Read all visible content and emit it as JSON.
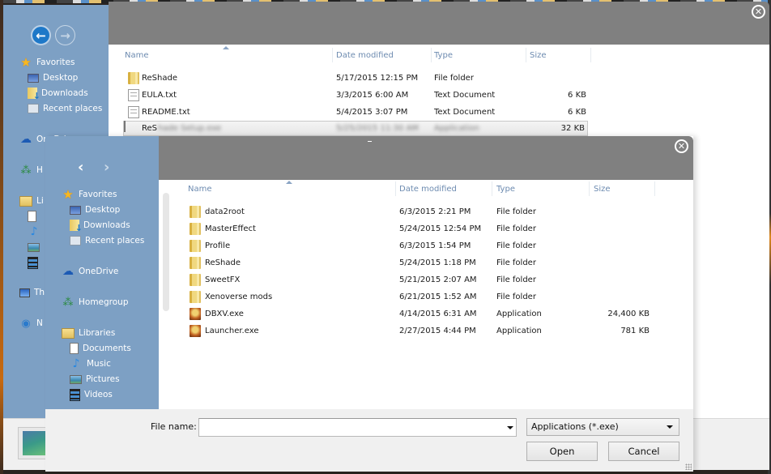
{
  "background_window": {
    "nav": {
      "back_icon": "arrow-left-icon",
      "forward_icon": "arrow-right-icon"
    },
    "sidebar": {
      "items": [
        {
          "label": "Favorites",
          "icon": "star-icon"
        },
        {
          "label": "Desktop",
          "icon": "desktop-icon"
        },
        {
          "label": "Downloads",
          "icon": "downloads-icon"
        },
        {
          "label": "Recent places",
          "icon": "recent-places-icon"
        },
        {
          "label": "OneDrive",
          "icon": "onedrive-icon"
        },
        {
          "label": "Homegroup",
          "icon": "homegroup-icon"
        },
        {
          "label": "Libraries",
          "icon": "libraries-icon"
        },
        {
          "label": "This PC",
          "icon": "computer-icon"
        },
        {
          "label": "Network",
          "icon": "network-icon"
        }
      ],
      "visible_fragments": {
        "onedrive": "OneDrive",
        "homegroup": "H",
        "libraries": "Li",
        "thispc": "Th",
        "network": "N"
      }
    },
    "columns": {
      "name": "Name",
      "date": "Date modified",
      "type": "Type",
      "size": "Size"
    },
    "files": [
      {
        "name": "ReShade",
        "date": "5/17/2015 12:15 PM",
        "type": "File folder",
        "size": "",
        "icon": "folder-icon"
      },
      {
        "name": "EULA.txt",
        "date": "3/3/2015 6:00 AM",
        "type": "Text Document",
        "size": "6 KB",
        "icon": "text-file-icon"
      },
      {
        "name": "README.txt",
        "date": "5/4/2015 3:07 PM",
        "type": "Text Document",
        "size": "6 KB",
        "icon": "text-file-icon"
      },
      {
        "name": "ReShade Setup.exe",
        "name_visible": "ReS",
        "name_blurred": "hade Setup.exe",
        "date": "5/25/2015 11:30 AM",
        "type": "Application",
        "size": "32 KB",
        "icon": "installer-icon"
      }
    ],
    "close_icon": "close-icon"
  },
  "dialog": {
    "title": "",
    "nav": {
      "back_icon": "chevron-left-icon",
      "forward_icon": "chevron-right-icon"
    },
    "sidebar": {
      "groups": [
        {
          "label": "Favorites",
          "icon": "star-icon",
          "children": [
            {
              "label": "Desktop",
              "icon": "desktop-icon"
            },
            {
              "label": "Downloads",
              "icon": "downloads-icon"
            },
            {
              "label": "Recent places",
              "icon": "recent-places-icon"
            }
          ]
        },
        {
          "label": "OneDrive",
          "icon": "onedrive-icon",
          "children": []
        },
        {
          "label": "Homegroup",
          "icon": "homegroup-icon",
          "children": []
        },
        {
          "label": "Libraries",
          "icon": "libraries-icon",
          "children": [
            {
              "label": "Documents",
              "icon": "documents-icon"
            },
            {
              "label": "Music",
              "icon": "music-icon"
            },
            {
              "label": "Pictures",
              "icon": "pictures-icon"
            },
            {
              "label": "Videos",
              "icon": "videos-icon"
            }
          ]
        }
      ]
    },
    "columns": {
      "name": "Name",
      "date": "Date modified",
      "type": "Type",
      "size": "Size"
    },
    "files": [
      {
        "name": "data2root",
        "date": "6/3/2015 2:21 PM",
        "type": "File folder",
        "size": "",
        "icon": "folder-icon"
      },
      {
        "name": "MasterEffect",
        "date": "5/24/2015 12:54 PM",
        "type": "File folder",
        "size": "",
        "icon": "folder-icon"
      },
      {
        "name": "Profile",
        "date": "6/3/2015 1:54 PM",
        "type": "File folder",
        "size": "",
        "icon": "folder-icon"
      },
      {
        "name": "ReShade",
        "date": "5/24/2015 1:18 PM",
        "type": "File folder",
        "size": "",
        "icon": "folder-icon"
      },
      {
        "name": "SweetFX",
        "date": "5/21/2015 2:07 AM",
        "type": "File folder",
        "size": "",
        "icon": "folder-icon"
      },
      {
        "name": "Xenoverse mods",
        "date": "6/21/2015 1:52 AM",
        "type": "File folder",
        "size": "",
        "icon": "folder-icon"
      },
      {
        "name": "DBXV.exe",
        "date": "4/14/2015 6:31 AM",
        "type": "Application",
        "size": "24,400 KB",
        "icon": "game-exe-icon"
      },
      {
        "name": "Launcher.exe",
        "date": "2/27/2015 4:44 PM",
        "type": "Application",
        "size": "781 KB",
        "icon": "game-exe-icon"
      }
    ],
    "footer": {
      "file_name_label": "File name:",
      "file_name_value": "",
      "file_name_placeholder": "",
      "filter_selected": "Applications (*.exe)",
      "open_label": "Open",
      "cancel_label": "Cancel"
    },
    "close_icon": "close-icon"
  },
  "colors": {
    "sidebar_bg": "#7da0c4",
    "titlebar_bg": "#808080",
    "header_text": "#6d8bb0",
    "back_button": "#1e78c8"
  }
}
